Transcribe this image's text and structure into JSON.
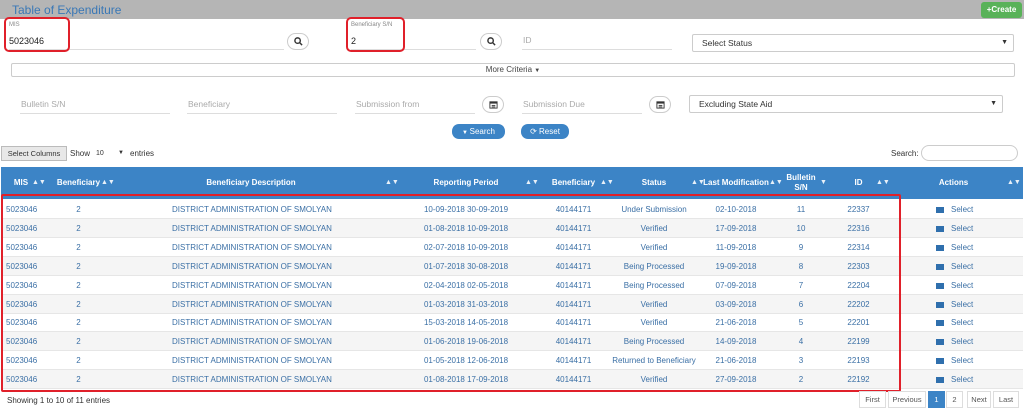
{
  "header": {
    "title": "Table of Expenditure",
    "create_label": "Create",
    "create_icon": "+"
  },
  "filters": {
    "mis": {
      "label": "MIS",
      "value": "5023046"
    },
    "beneficiary_sn": {
      "label": "Beneficiary S/N",
      "value": "2"
    },
    "id_placeholder": "ID",
    "status_select": "Select Status",
    "more_criteria": "More Criteria",
    "bulletin_placeholder": "Bulletin S/N",
    "beneficiary_placeholder": "Beneficiary",
    "submission_from_placeholder": "Submission from",
    "submission_due_placeholder": "Submission Due",
    "state_aid_select": "Excluding State Aid",
    "search_label": "Search",
    "reset_label": "Reset"
  },
  "table_controls": {
    "select_columns": "Select Columns",
    "show_label": "Show",
    "entries_value": "10",
    "entries_label": "entries",
    "search_label": "Search:"
  },
  "table": {
    "headers": [
      "MIS",
      "Beneficiary",
      "Beneficiary Description",
      "Reporting Period",
      "Beneficiary",
      "Status",
      "Last Modification",
      "Bulletin S/N",
      "ID",
      "Actions"
    ],
    "rows": [
      {
        "mis": "5023046",
        "ben": "2",
        "desc": "DISTRICT ADMINISTRATION OF SMOLYAN",
        "period": "10-09-2018 30-09-2019",
        "ben_code": "40144171",
        "status": "Under Submission",
        "modified": "02-10-2018",
        "bulletin": "11",
        "id": "22337",
        "action": "Select"
      },
      {
        "mis": "5023046",
        "ben": "2",
        "desc": "DISTRICT ADMINISTRATION OF SMOLYAN",
        "period": "01-08-2018 10-09-2018",
        "ben_code": "40144171",
        "status": "Verified",
        "modified": "17-09-2018",
        "bulletin": "10",
        "id": "22316",
        "action": "Select"
      },
      {
        "mis": "5023046",
        "ben": "2",
        "desc": "DISTRICT ADMINISTRATION OF SMOLYAN",
        "period": "02-07-2018 10-09-2018",
        "ben_code": "40144171",
        "status": "Verified",
        "modified": "11-09-2018",
        "bulletin": "9",
        "id": "22314",
        "action": "Select"
      },
      {
        "mis": "5023046",
        "ben": "2",
        "desc": "DISTRICT ADMINISTRATION OF SMOLYAN",
        "period": "01-07-2018 30-08-2018",
        "ben_code": "40144171",
        "status": "Being Processed",
        "modified": "19-09-2018",
        "bulletin": "8",
        "id": "22303",
        "action": "Select"
      },
      {
        "mis": "5023046",
        "ben": "2",
        "desc": "DISTRICT ADMINISTRATION OF SMOLYAN",
        "period": "02-04-2018 02-05-2018",
        "ben_code": "40144171",
        "status": "Being Processed",
        "modified": "07-09-2018",
        "bulletin": "7",
        "id": "22204",
        "action": "Select"
      },
      {
        "mis": "5023046",
        "ben": "2",
        "desc": "DISTRICT ADMINISTRATION OF SMOLYAN",
        "period": "01-03-2018 31-03-2018",
        "ben_code": "40144171",
        "status": "Verified",
        "modified": "03-09-2018",
        "bulletin": "6",
        "id": "22202",
        "action": "Select"
      },
      {
        "mis": "5023046",
        "ben": "2",
        "desc": "DISTRICT ADMINISTRATION OF SMOLYAN",
        "period": "15-03-2018 14-05-2018",
        "ben_code": "40144171",
        "status": "Verified",
        "modified": "21-06-2018",
        "bulletin": "5",
        "id": "22201",
        "action": "Select"
      },
      {
        "mis": "5023046",
        "ben": "2",
        "desc": "DISTRICT ADMINISTRATION OF SMOLYAN",
        "period": "01-06-2018 19-06-2018",
        "ben_code": "40144171",
        "status": "Being Processed",
        "modified": "14-09-2018",
        "bulletin": "4",
        "id": "22199",
        "action": "Select"
      },
      {
        "mis": "5023046",
        "ben": "2",
        "desc": "DISTRICT ADMINISTRATION OF SMOLYAN",
        "period": "01-05-2018 12-06-2018",
        "ben_code": "40144171",
        "status": "Returned to Beneficiary",
        "modified": "21-06-2018",
        "bulletin": "3",
        "id": "22193",
        "action": "Select"
      },
      {
        "mis": "5023046",
        "ben": "2",
        "desc": "DISTRICT ADMINISTRATION OF SMOLYAN",
        "period": "01-08-2018 17-09-2018",
        "ben_code": "40144171",
        "status": "Verified",
        "modified": "27-09-2018",
        "bulletin": "2",
        "id": "22192",
        "action": "Select"
      }
    ]
  },
  "footer": {
    "info": "Showing 1 to 10 of 11 entries",
    "pagination": [
      "First",
      "Previous",
      "1",
      "2",
      "Next",
      "Last"
    ],
    "active_page": "1"
  },
  "icons": [
    "search-icon",
    "calendar-icon",
    "caret-down-icon",
    "sort-icon",
    "menu-icon",
    "refresh-icon"
  ],
  "colors": {
    "accent": "#3c84c6",
    "highlight": "#e0202a",
    "create": "#59b259"
  }
}
